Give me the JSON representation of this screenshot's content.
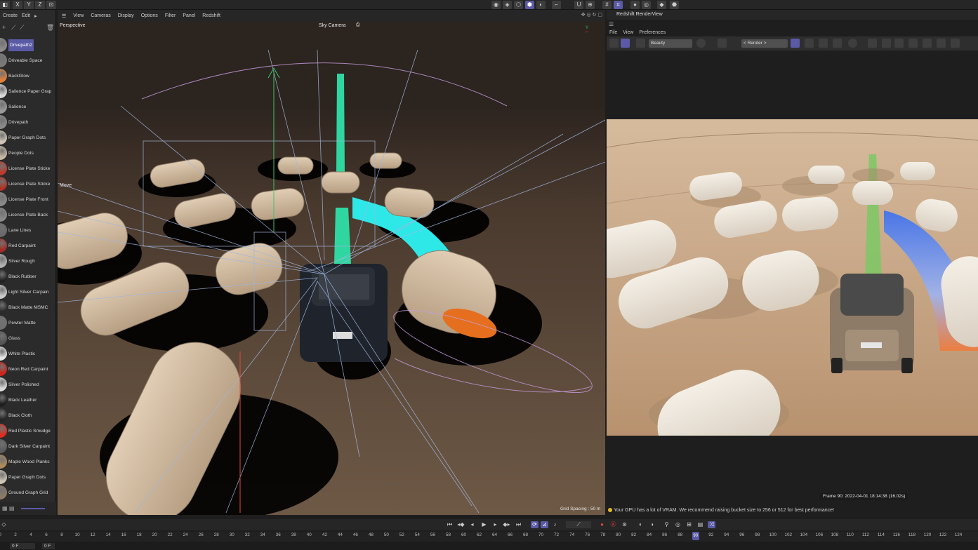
{
  "top_axis_buttons": [
    "X",
    "Y",
    "Z"
  ],
  "left_menu": {
    "create": "Create",
    "edit": "Edit",
    "more": "▸"
  },
  "materials": [
    {
      "name": "Drivepath2",
      "color": "#8c8c8c",
      "selected": true
    },
    {
      "name": "Driveable Space",
      "color": "#7a7a7a"
    },
    {
      "name": "BackGlow",
      "color": "#e0803a"
    },
    {
      "name": "Salience Paper Grap",
      "color": "#d8d8d8"
    },
    {
      "name": "Salience",
      "color": "#9a9a9a"
    },
    {
      "name": "Drivepath",
      "color": "#8a8a8a"
    },
    {
      "name": "Paper Graph Dots",
      "color": "#cfc6b8"
    },
    {
      "name": "People Dots",
      "color": "#c7b9a3"
    },
    {
      "name": "License Plate Sticke",
      "color": "#c0392b"
    },
    {
      "name": "License Plate Sticke",
      "color": "#b23226"
    },
    {
      "name": "License Plate Front",
      "color": "#8a8a8a"
    },
    {
      "name": "License Plate Back",
      "color": "#8a8a8a"
    },
    {
      "name": "Lane Lines",
      "color": "#6a6a6a"
    },
    {
      "name": "Red Carpaint",
      "color": "#a52a25"
    },
    {
      "name": "Silver Rough",
      "color": "#b0b0b0"
    },
    {
      "name": "Black Rubber",
      "color": "#222222"
    },
    {
      "name": "Light Silver Carpain",
      "color": "#c8c8c8"
    },
    {
      "name": "Black Matte MSMC",
      "color": "#2a2a2a"
    },
    {
      "name": "Pewter Matte",
      "color": "#6f6f6f"
    },
    {
      "name": "Glass",
      "color": "#555555"
    },
    {
      "name": "White Plastic",
      "color": "#e6e6e6"
    },
    {
      "name": "Neon Red Carpaint",
      "color": "#d1211a"
    },
    {
      "name": "Silver Polished",
      "color": "#dcdcdc"
    },
    {
      "name": "Black Leather",
      "color": "#1e1e1e"
    },
    {
      "name": "Black Cloth",
      "color": "#262626"
    },
    {
      "name": "Red Plastic Smudge",
      "color": "#e02a1f"
    },
    {
      "name": "Dark Silver Carpaint",
      "color": "#5c5c5c"
    },
    {
      "name": "Maple Wood Planks",
      "color": "#b08a5a"
    },
    {
      "name": "Paper Graph Dots",
      "color": "#cfc6b8"
    },
    {
      "name": "Ground Graph Grid",
      "color": "#8e7a66"
    }
  ],
  "viewport_menu": [
    "View",
    "Cameras",
    "Display",
    "Options",
    "Filter",
    "Panel",
    "Redshift"
  ],
  "viewport": {
    "perspective_label": "Perspective",
    "camera_label": "Sky Camera",
    "move_label": "Move",
    "grid_label": "Grid Spacing : 50 m"
  },
  "renderview": {
    "title": "Redshift RenderView",
    "menu": [
      "File",
      "View",
      "Preferences"
    ],
    "aov_select": "Beauty",
    "render_select": "< Render >",
    "frame_info": "Frame 90:  2022-04-01 18:14:38  (16.02s)",
    "status": "Your GPU has a lot of VRAM. We recommend raising bucket size to 256 or 512 for best performance!"
  },
  "timeline": {
    "ticks": [
      "0",
      "2",
      "4",
      "6",
      "8",
      "10",
      "12",
      "14",
      "16",
      "18",
      "20",
      "22",
      "24",
      "26",
      "28",
      "30",
      "32",
      "34",
      "36",
      "38",
      "40",
      "42",
      "44",
      "46",
      "48",
      "50",
      "52",
      "54",
      "56",
      "58",
      "60",
      "62",
      "64",
      "66",
      "68",
      "70",
      "72",
      "74",
      "76",
      "78",
      "80",
      "82",
      "84",
      "86",
      "88",
      "90",
      "92",
      "94",
      "96",
      "98",
      "100",
      "102",
      "104",
      "106",
      "108",
      "110",
      "112",
      "114",
      "116",
      "118",
      "120",
      "122",
      "124",
      "126"
    ],
    "current_frame": "90",
    "start_field": "0 F",
    "end_field": "0 F"
  },
  "colors": {
    "accent": "#5a5aa6",
    "panel": "#2b2b2b",
    "viewport_bg": "#3b2f26",
    "render_bg": "#c9a989",
    "warning": "#e3b62b"
  }
}
